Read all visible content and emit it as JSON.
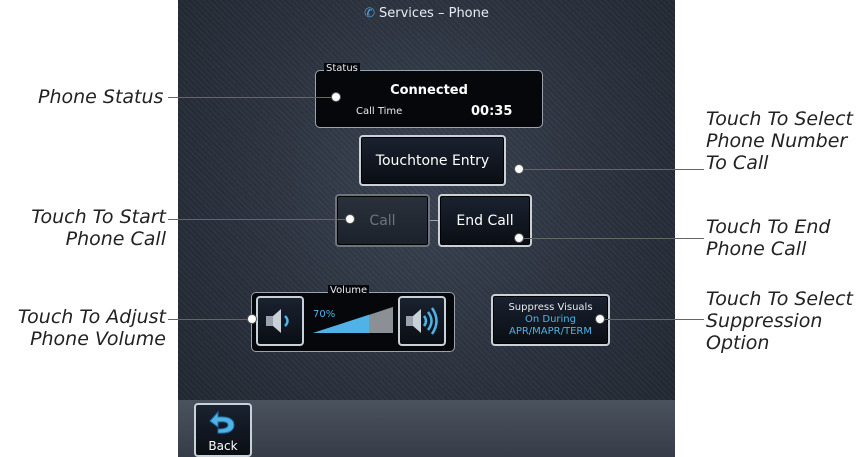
{
  "screen": {
    "title": "Services – Phone",
    "title_icon": "phone-icon"
  },
  "status": {
    "label": "Status",
    "state": "Connected",
    "call_time_label": "Call Time",
    "call_time_value": "00:35"
  },
  "buttons": {
    "touchtone": "Touchtone Entry",
    "call": "Call",
    "end_call": "End Call",
    "back": "Back"
  },
  "volume": {
    "label": "Volume",
    "percent_text": "70%",
    "level": 0.7,
    "down_icon": "speaker-low-icon",
    "up_icon": "speaker-high-icon"
  },
  "suppress": {
    "line1": "Suppress Visuals",
    "line2": "On During",
    "line3": "APR/MAPR/TERM"
  },
  "callouts": {
    "phone_status": "Phone Status",
    "start_call_1": "Touch To Start",
    "start_call_2": "Phone Call",
    "adjust_volume_1": "Touch To Adjust",
    "adjust_volume_2": "Phone Volume",
    "select_number_1": "Touch To Select",
    "select_number_2": "Phone Number",
    "select_number_3": "To Call",
    "end_call_1": "Touch To End",
    "end_call_2": "Phone Call",
    "suppression_1": "Touch To Select",
    "suppression_2": "Suppression",
    "suppression_3": "Option"
  },
  "colors": {
    "accent": "#4fb3e6",
    "screen_bg": "#2a313d",
    "button_border": "#c8d0d8"
  }
}
